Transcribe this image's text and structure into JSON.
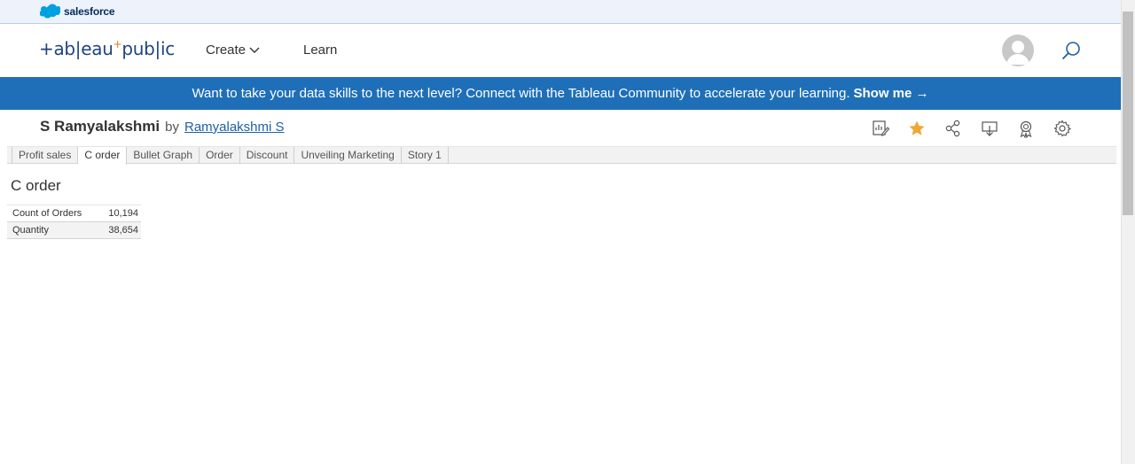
{
  "salesforce": {
    "brand": "salesforce",
    "icon": "salesforce-cloud-icon"
  },
  "header": {
    "logo_pre": "+ab|eau",
    "logo_plus": "+",
    "logo_post": "pub|ic",
    "nav": {
      "create_label": "Create",
      "learn_label": "Learn"
    },
    "icons": {
      "avatar": "avatar-icon",
      "search": "search-icon"
    }
  },
  "banner": {
    "text": "Want to take your data skills to the next level? Connect with the Tableau Community to accelerate your learning.",
    "cta": "Show me →"
  },
  "viz": {
    "title": "S Ramyalakshmi",
    "by": "by",
    "author": "Ramyalakshmi S",
    "toolbar_icons": [
      "edit-icon",
      "star-icon",
      "share-icon",
      "download-icon",
      "badge-icon",
      "settings-icon"
    ]
  },
  "tabs": [
    {
      "label": "Profit sales",
      "active": false
    },
    {
      "label": "C order",
      "active": true
    },
    {
      "label": "Bullet Graph",
      "active": false
    },
    {
      "label": "Order",
      "active": false
    },
    {
      "label": "Discount",
      "active": false
    },
    {
      "label": "Unveiling Marketing",
      "active": false
    },
    {
      "label": "Story 1",
      "active": false
    }
  ],
  "sheet": {
    "title": "C order",
    "rows": [
      {
        "label": "Count of Orders",
        "value": "10,194"
      },
      {
        "label": "Quantity",
        "value": "38,654"
      }
    ]
  },
  "colors": {
    "banner": "#1f6fb8",
    "star": "#f0a832",
    "link": "#1f5fa6",
    "logo": "#1f457e"
  }
}
